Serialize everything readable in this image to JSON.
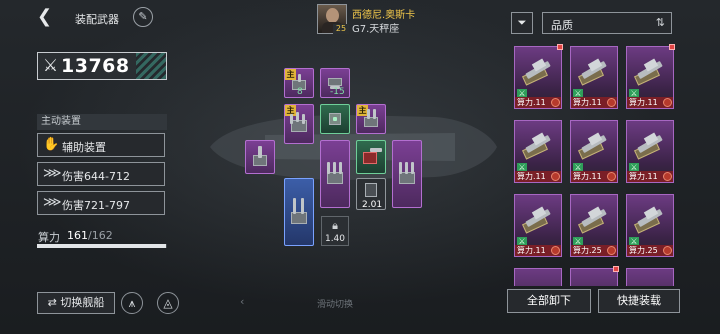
{
  "header": {
    "back_icon": "back-arrow-icon",
    "title": "装配武器",
    "edit_icon": "pencil-icon"
  },
  "power": {
    "icon": "crossed-swords-icon",
    "value": "13768"
  },
  "active_equipment": {
    "title": "主动装置",
    "items": [
      {
        "icon": "hand-icon",
        "label": "辅助装置"
      },
      {
        "icon": "claw-icon",
        "label": "伤害644-712"
      },
      {
        "icon": "claw-icon",
        "label": "伤害721-797"
      }
    ]
  },
  "computing": {
    "label": "算力",
    "current": "161",
    "max": "/162",
    "fill_fraction": 0.994
  },
  "bottom_left": {
    "switch_ship": "⇄ 切换舰船",
    "btn2_icon": "wing-icon",
    "btn3_icon": "triangle-icon"
  },
  "pilot": {
    "name": "西德尼.奥斯卡",
    "level": "25",
    "ship": "G7.天秤座"
  },
  "slots": {
    "main_tag": "主",
    "slot1_value": "8",
    "slot2_value": "-15",
    "slot3_value": "2.01",
    "lock_value": "1.40"
  },
  "swipe_hint": "滑动切换",
  "filter": {
    "icon": "filter-icon",
    "quality_label": "品质",
    "sort_icon": "sort-icon"
  },
  "inventory": {
    "cards": [
      {
        "label": "算力.11",
        "badge": true
      },
      {
        "label": "算力.11",
        "badge": false
      },
      {
        "label": "算力.11",
        "badge": true
      },
      {
        "label": "算力.11",
        "badge": false
      },
      {
        "label": "算力.11",
        "badge": false
      },
      {
        "label": "算力.11",
        "badge": false
      },
      {
        "label": "算力.11",
        "badge": false
      },
      {
        "label": "算力.25",
        "badge": false
      },
      {
        "label": "算力.25",
        "badge": false
      }
    ]
  },
  "buttons": {
    "unload_all": "全部卸下",
    "quick_equip": "快捷装载"
  },
  "colors": {
    "purple_quality": "#7b3f94",
    "blue_quality": "#3c5ea8",
    "green_quality": "#2f6b4e",
    "footer_red": "#7a1f27",
    "gold_text": "#f2c84b"
  }
}
